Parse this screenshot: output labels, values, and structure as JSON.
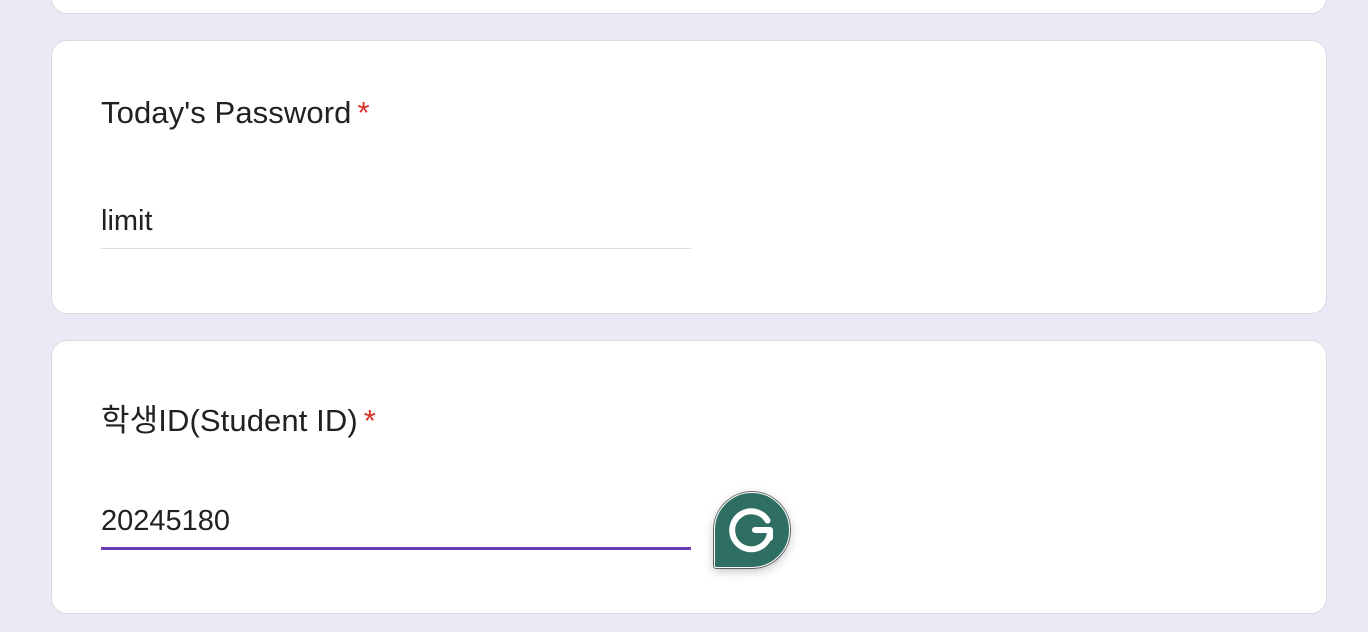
{
  "form": {
    "questions": [
      {
        "title": "Today's Password",
        "required_mark": "*",
        "answer": "limit",
        "focused": false
      },
      {
        "title": "학생ID(Student ID)",
        "required_mark": "*",
        "answer": "20245180",
        "focused": true
      }
    ]
  },
  "colors": {
    "page_background": "#ede8f6",
    "card_background": "#ffffff",
    "required": "#d93025",
    "focus_underline": "#673ab7",
    "grammarly": "#2f6f63"
  },
  "icons": {
    "grammarly_button": "grammarly-g-icon",
    "drag_handle": "drag-dots-icon"
  }
}
